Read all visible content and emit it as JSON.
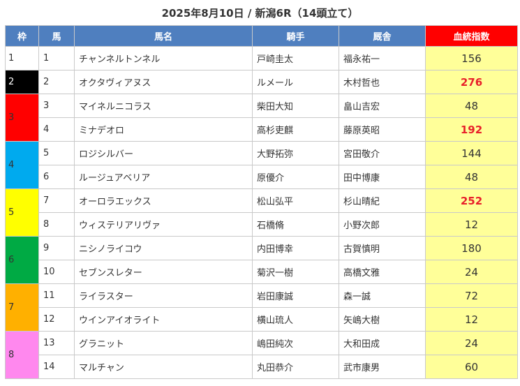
{
  "title": "2025年8月10日 / 新潟6R（14頭立て）",
  "headers": {
    "waku": "枠",
    "uma": "馬",
    "name": "馬名",
    "jockey": "騎手",
    "stable": "厩舎",
    "score": "血統指数"
  },
  "colors": {
    "header_bg": "#4f7fbf",
    "score_header_bg": "#ff0000",
    "score_cell_bg": "#ffff99",
    "highlight_text": "#e8202a"
  },
  "waku_groups": [
    {
      "label": "1",
      "color": "#ffffff",
      "text_color": "#333333",
      "rows": 1
    },
    {
      "label": "2",
      "color": "#000000",
      "text_color": "#ffffff",
      "rows": 1
    },
    {
      "label": "3",
      "color": "#ff0000",
      "text_color": "#333333",
      "rows": 2
    },
    {
      "label": "4",
      "color": "#00aaee",
      "text_color": "#333333",
      "rows": 2
    },
    {
      "label": "5",
      "color": "#ffff00",
      "text_color": "#333333",
      "rows": 2
    },
    {
      "label": "6",
      "color": "#00aa44",
      "text_color": "#333333",
      "rows": 2
    },
    {
      "label": "7",
      "color": "#ffb000",
      "text_color": "#333333",
      "rows": 2
    },
    {
      "label": "8",
      "color": "#ff88ee",
      "text_color": "#333333",
      "rows": 2
    }
  ],
  "horses": [
    {
      "num": "1",
      "name": "チャンネルトンネル",
      "jockey": "戸崎圭太",
      "stable": "福永祐一",
      "score": "156",
      "highlight": false
    },
    {
      "num": "2",
      "name": "オクタヴィアヌス",
      "jockey": "ルメール",
      "stable": "木村哲也",
      "score": "276",
      "highlight": true
    },
    {
      "num": "3",
      "name": "マイネルニコラス",
      "jockey": "柴田大知",
      "stable": "畠山吉宏",
      "score": "48",
      "highlight": false
    },
    {
      "num": "4",
      "name": "ミナデオロ",
      "jockey": "高杉吏麒",
      "stable": "藤原英昭",
      "score": "192",
      "highlight": true
    },
    {
      "num": "5",
      "name": "ロジシルバー",
      "jockey": "大野拓弥",
      "stable": "宮田敬介",
      "score": "144",
      "highlight": false
    },
    {
      "num": "6",
      "name": "ルージュアベリア",
      "jockey": "原優介",
      "stable": "田中博康",
      "score": "48",
      "highlight": false
    },
    {
      "num": "7",
      "name": "オーロラエックス",
      "jockey": "松山弘平",
      "stable": "杉山晴紀",
      "score": "252",
      "highlight": true
    },
    {
      "num": "8",
      "name": "ウィステリアリヴァ",
      "jockey": "石橋脩",
      "stable": "小野次郎",
      "score": "12",
      "highlight": false
    },
    {
      "num": "9",
      "name": "ニシノライコウ",
      "jockey": "内田博幸",
      "stable": "古賀慎明",
      "score": "180",
      "highlight": false
    },
    {
      "num": "10",
      "name": "セブンスレター",
      "jockey": "菊沢一樹",
      "stable": "高橋文雅",
      "score": "24",
      "highlight": false
    },
    {
      "num": "11",
      "name": "ライラスター",
      "jockey": "岩田康誠",
      "stable": "森一誠",
      "score": "72",
      "highlight": false
    },
    {
      "num": "12",
      "name": "ウインアイオライト",
      "jockey": "横山琉人",
      "stable": "矢嶋大樹",
      "score": "12",
      "highlight": false
    },
    {
      "num": "13",
      "name": "グラニット",
      "jockey": "嶋田純次",
      "stable": "大和田成",
      "score": "24",
      "highlight": false
    },
    {
      "num": "14",
      "name": "マルチャン",
      "jockey": "丸田恭介",
      "stable": "武市康男",
      "score": "60",
      "highlight": false
    }
  ]
}
